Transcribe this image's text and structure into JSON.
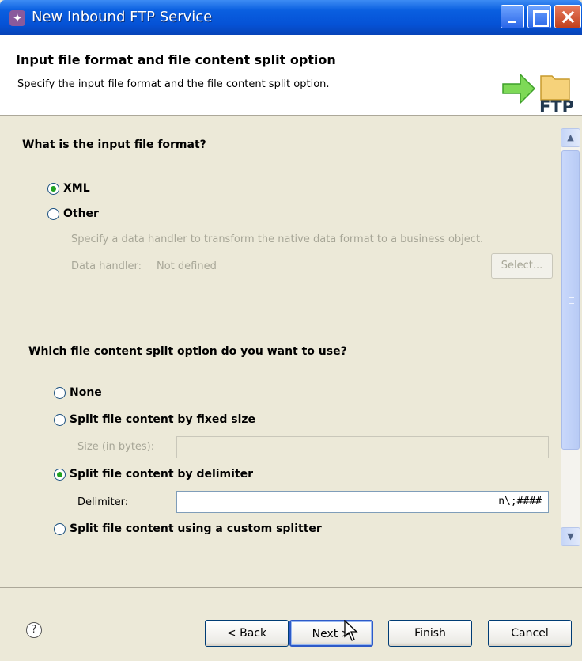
{
  "window": {
    "title": "New Inbound FTP Service",
    "badge_text": "FTP"
  },
  "header": {
    "title": "Input file format and file content split option",
    "description": "Specify the input file format and the file content split option."
  },
  "format_section": {
    "question": "What is the input file format?",
    "options": [
      {
        "label": "XML",
        "selected": true
      },
      {
        "label": "Other",
        "selected": false
      }
    ],
    "other_hint": "Specify a data handler to transform the native data format to a business object.",
    "data_handler_label": "Data handler:",
    "data_handler_value": "Not defined",
    "select_button": "Select..."
  },
  "split_section": {
    "question": "Which file content split option do you want to use?",
    "options": [
      {
        "label": "None",
        "selected": false
      },
      {
        "label": "Split file content by fixed size",
        "selected": false
      },
      {
        "label": "Split file content by delimiter",
        "selected": true
      },
      {
        "label": "Split file content using a custom splitter",
        "selected": false
      }
    ],
    "size_label": "Size (in bytes):",
    "size_value": "",
    "delimiter_label": "Delimiter:",
    "delimiter_value": "n\\;####"
  },
  "buttons": {
    "help": "?",
    "back": "< Back",
    "next": "Next >",
    "finish": "Finish",
    "cancel": "Cancel"
  }
}
